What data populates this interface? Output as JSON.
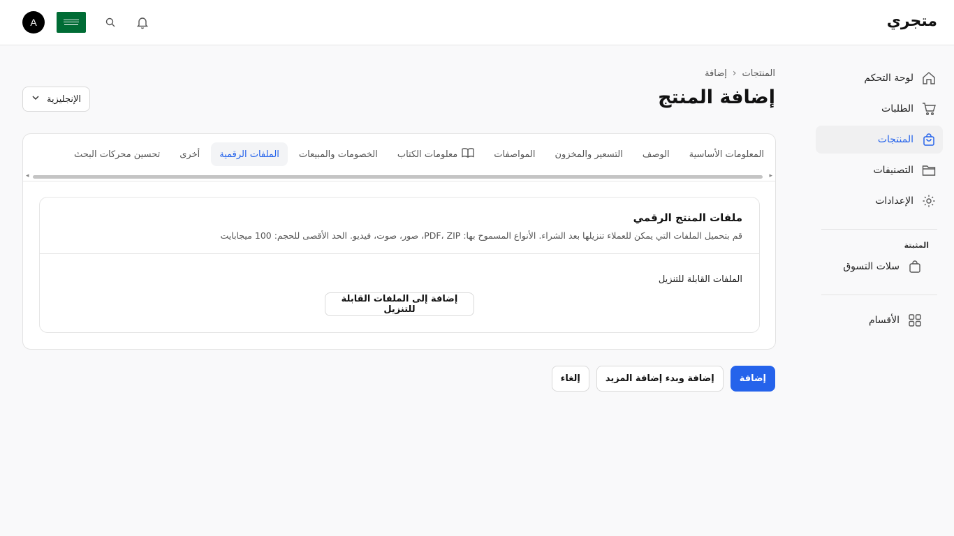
{
  "header": {
    "brand": "متجري",
    "avatar_initial": "A",
    "icons": [
      "search-icon",
      "bell-icon"
    ]
  },
  "sidebar": {
    "items": [
      {
        "label": "لوحة التحكم",
        "icon": "home-icon"
      },
      {
        "label": "الطلبات",
        "icon": "cart-icon"
      },
      {
        "label": "المنتجات",
        "icon": "bag-icon",
        "active": true
      },
      {
        "label": "التصنيفات",
        "icon": "folder-icon"
      },
      {
        "label": "الإعدادات",
        "icon": "gear-icon"
      }
    ],
    "pinned_title": "المثبتة",
    "pinned_items": [
      {
        "label": "سلات التسوق",
        "icon": "bag-icon"
      }
    ],
    "sections_label": "الأقسام"
  },
  "breadcrumb": {
    "parent": "المنتجات",
    "current": "إضافة"
  },
  "page_title": "إضافة المنتج",
  "language_select": {
    "value": "الإنجليزية"
  },
  "tabs": [
    {
      "label": "المعلومات الأساسية"
    },
    {
      "label": "الوصف"
    },
    {
      "label": "التسعير والمخزون"
    },
    {
      "label": "المواصفات"
    },
    {
      "label": "معلومات الكتاب",
      "icon": "book-icon"
    },
    {
      "label": "الخصومات والمبيعات"
    },
    {
      "label": "الملفات الرقمية",
      "active": true
    },
    {
      "label": "أخرى"
    },
    {
      "label": "تحسين محركات البحث"
    }
  ],
  "digital_files": {
    "title": "ملفات المنتج الرقمي",
    "description": "قم بتحميل الملفات التي يمكن للعملاء تنزيلها بعد الشراء. الأنواع المسموح بها: PDF، ZIP، صور، صوت، فيديو. الحد الأقصى للحجم: 100 ميجابايت",
    "downloadable_label": "الملفات القابلة للتنزيل",
    "add_button": "إضافة إلى الملفات القابلة للتنزيل"
  },
  "actions": {
    "add": "إضافة",
    "add_and_more": "إضافة وبدء إضافة المزيد",
    "cancel": "إلغاء"
  },
  "colors": {
    "accent": "#2563eb",
    "flag_green": "#006c35"
  }
}
